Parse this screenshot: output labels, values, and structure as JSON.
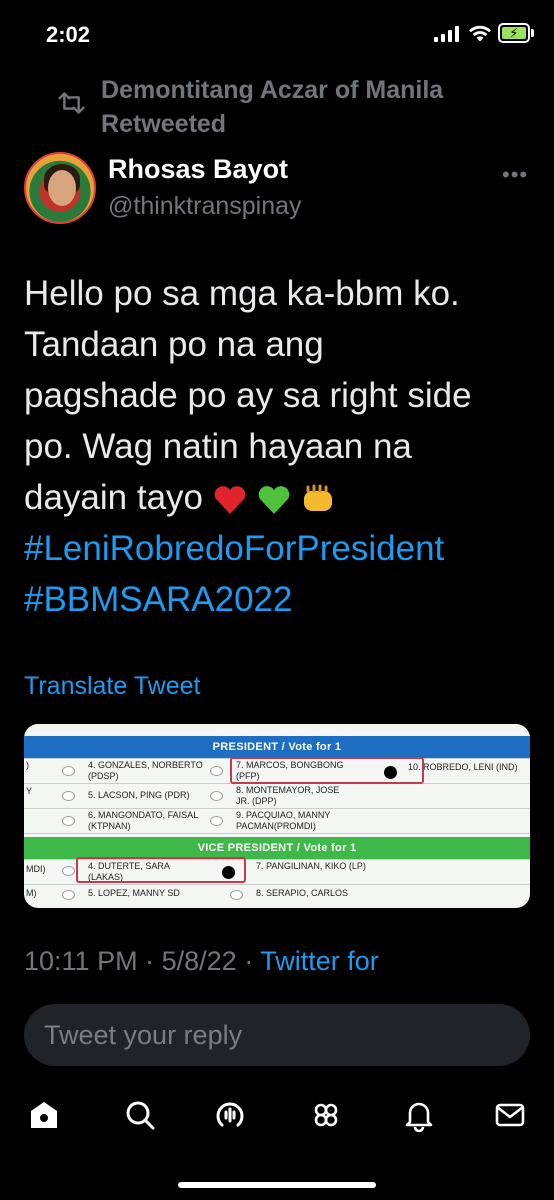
{
  "status_bar": {
    "time": "2:02"
  },
  "retweet": {
    "label": "Demontitang Aczar of Manila Retweeted"
  },
  "author": {
    "name": "Rhosas Bayot",
    "handle": "@thinktranspinay"
  },
  "tweet": {
    "text_lines": [
      "Hello po sa mga ka-bbm ko.",
      "Tandaan po na ang",
      "pagshade po ay sa right side",
      "po. Wag natin hayaan na",
      "dayain tayo"
    ],
    "hashtags": [
      "#LeniRobredoForPresident",
      "#BBMSARA2022"
    ],
    "translate_label": "Translate Tweet"
  },
  "ballot": {
    "president_header": "PRESIDENT / Vote for 1",
    "vp_header": "VICE PRESIDENT / Vote for 1",
    "president_rows": [
      [
        "4. GONZALES, NORBERTO (PDSP)",
        "7. MARCOS, BONGBONG (PFP)",
        "10. ROBREDO, LENI (IND)"
      ],
      [
        "5. LACSON, PING (PDR)",
        "8. MONTEMAYOR, JOSE JR. (DPP)",
        ""
      ],
      [
        "6. MANGONDATO, FAISAL (KTPNAN)",
        "9. PACQUIAO, MANNY PACMAN(PROMDI)",
        ""
      ]
    ],
    "vp_rows": [
      [
        "4. DUTERTE, SARA (LAKAS)",
        "7. PANGILINAN, KIKO (LP)"
      ],
      [
        "5. LOPEZ, MANNY SD",
        "8. SERAPIO, CARLOS"
      ]
    ],
    "left_edge_fragments": [
      ")",
      "Y",
      "MDI)",
      "M)"
    ]
  },
  "meta": {
    "time": "10:11 PM",
    "separator": "·",
    "date": "5/8/22",
    "source": "Twitter for"
  },
  "reply": {
    "placeholder": "Tweet your reply"
  },
  "nav": [
    "home-icon",
    "search-icon",
    "spaces-icon",
    "communities-icon",
    "notifications-icon",
    "messages-icon"
  ],
  "colors": {
    "accent": "#1d9bf0",
    "muted": "#71767b",
    "background": "#000000"
  }
}
